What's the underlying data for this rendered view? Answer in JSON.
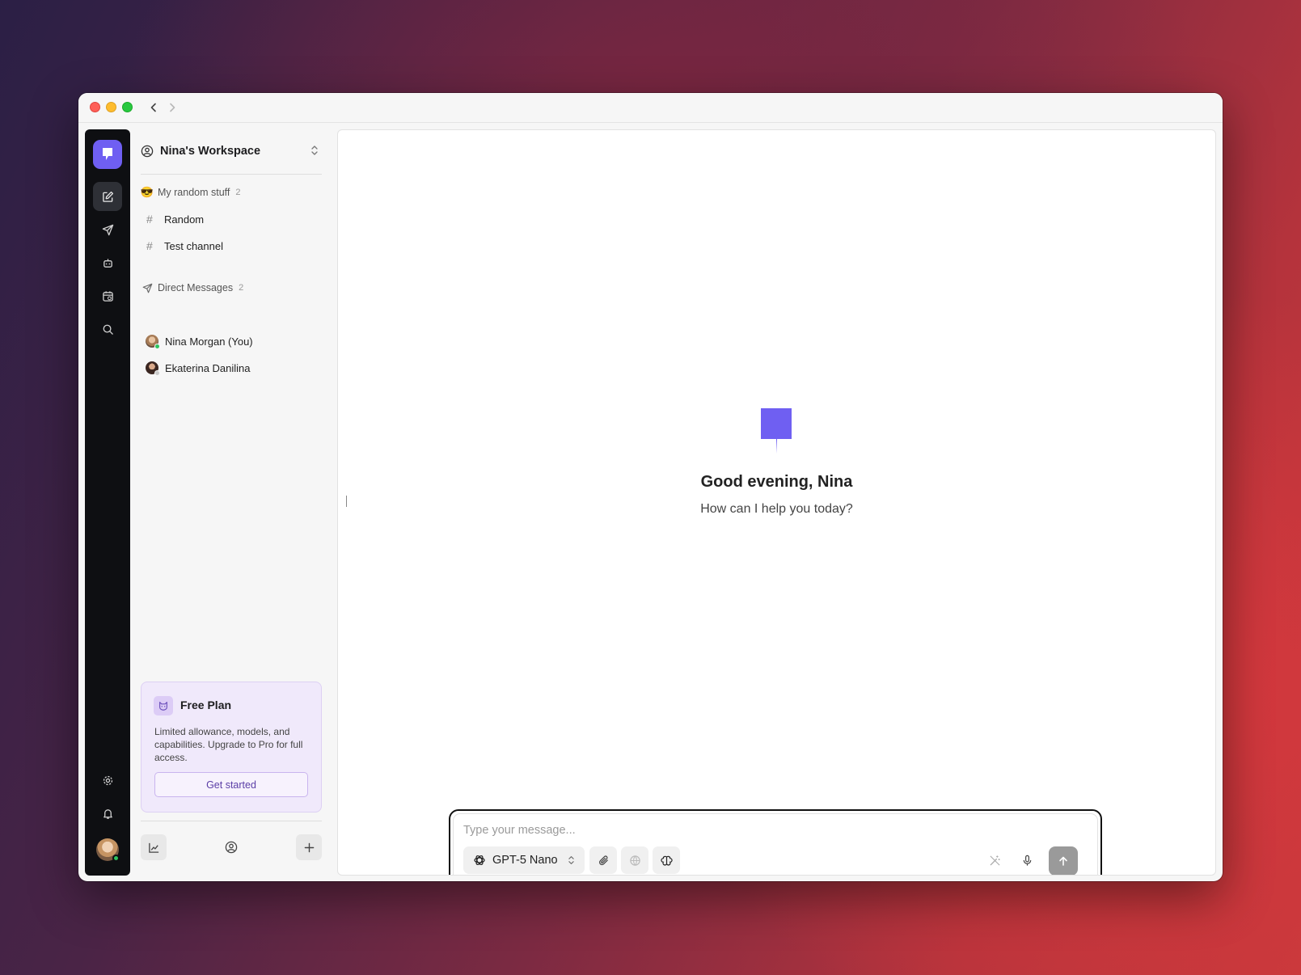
{
  "workspace": {
    "name": "Nina's Workspace"
  },
  "channels_section": {
    "emoji": "😎",
    "title": "My random stuff",
    "count": "2",
    "items": [
      {
        "label": "Random"
      },
      {
        "label": "Test channel"
      }
    ]
  },
  "dm_section": {
    "title": "Direct Messages",
    "count": "2",
    "items": [
      {
        "label": "Nina Morgan (You)",
        "status_color": "#2ec45f"
      },
      {
        "label": "Ekaterina Danilina",
        "status_color": "#c8c8c8"
      }
    ]
  },
  "plan": {
    "title": "Free Plan",
    "description": "Limited allowance, models, and capabilities. Upgrade to Pro for full access.",
    "cta": "Get started"
  },
  "main": {
    "greeting": "Good evening, Nina",
    "subtitle": "How can I help you today?"
  },
  "composer": {
    "placeholder": "Type your message...",
    "model": "GPT-5 Nano"
  },
  "colors": {
    "brand": "#6f5ff2",
    "rail": "#0e0f12",
    "plan_bg": "#f0e9fb",
    "send_disabled": "#9a9a9a"
  },
  "icons": {
    "rail": [
      "app-logo-icon",
      "compose-icon",
      "send-icon",
      "bot-icon",
      "calendar-icon",
      "search-icon",
      "settings-icon",
      "bell-icon"
    ],
    "composer": [
      "openai-icon",
      "paperclip-icon",
      "globe-icon",
      "brain-icon",
      "magic-wand-icon",
      "mic-icon",
      "arrow-up-icon"
    ]
  }
}
